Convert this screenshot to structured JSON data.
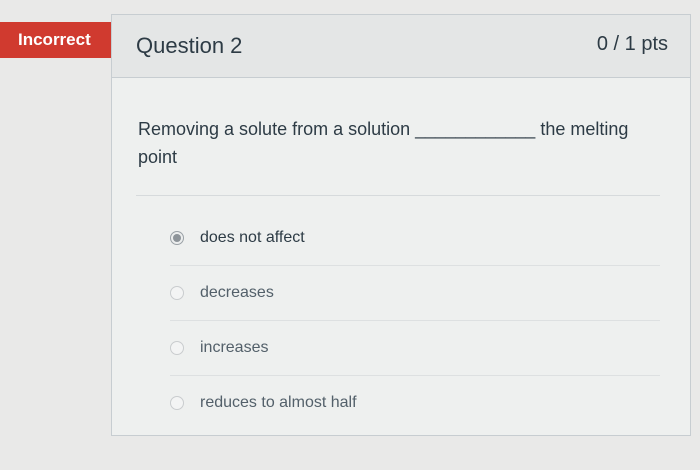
{
  "status": {
    "label": "Incorrect",
    "color": "#d03a2f"
  },
  "question": {
    "title": "Question 2",
    "points": "0 / 1 pts",
    "text_before": "Removing a solute from a solution",
    "blank": "____________",
    "text_after": "the melting point"
  },
  "answers": [
    {
      "label": "does not affect",
      "selected": true
    },
    {
      "label": "decreases",
      "selected": false
    },
    {
      "label": "increases",
      "selected": false
    },
    {
      "label": "reduces to almost half",
      "selected": false
    }
  ]
}
